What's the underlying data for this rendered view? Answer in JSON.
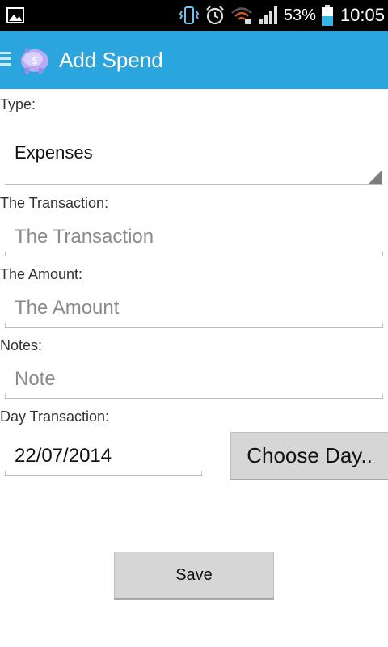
{
  "status_bar": {
    "battery_percent": "53%",
    "time": "10:05",
    "icons": [
      "image-icon",
      "vibrate-icon",
      "alarm-icon",
      "wifi-icon",
      "signal-icon",
      "battery-icon"
    ]
  },
  "action_bar": {
    "title": "Add Spend",
    "color": "#2aa5dd"
  },
  "form": {
    "type_label": "Type:",
    "type_value": "Expenses",
    "transaction_label": "The Transaction:",
    "transaction_placeholder": "The Transaction",
    "amount_label": "The Amount:",
    "amount_placeholder": "The Amount",
    "notes_label": "Notes:",
    "notes_placeholder": "Note",
    "day_label": "Day Transaction:",
    "day_value": "22/07/2014",
    "choose_day_button": "Choose Day..",
    "save_button": "Save"
  }
}
